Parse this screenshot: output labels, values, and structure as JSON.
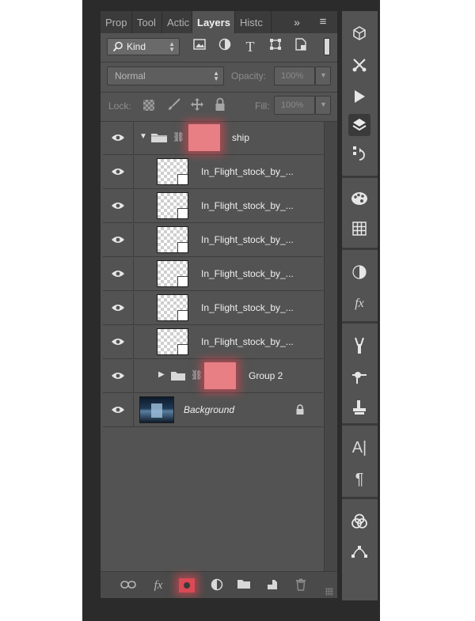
{
  "tabs": [
    {
      "label": "Prop",
      "active": false
    },
    {
      "label": "Tool",
      "active": false
    },
    {
      "label": "Actic",
      "active": false
    },
    {
      "label": "Layers",
      "active": true
    },
    {
      "label": "Histc",
      "active": false
    }
  ],
  "tab_controls": {
    "collapse": "»",
    "menu": "≡"
  },
  "filter": {
    "kind_label": "Kind"
  },
  "blend": {
    "mode": "Normal",
    "opacity_label": "Opacity:",
    "opacity_value": "100%"
  },
  "lock": {
    "label": "Lock:",
    "fill_label": "Fill:",
    "fill_value": "100%"
  },
  "layers": [
    {
      "name": "ship",
      "type": "group-open"
    },
    {
      "name": "In_Flight_stock_by_...",
      "type": "smart-object"
    },
    {
      "name": "In_Flight_stock_by_...",
      "type": "smart-object"
    },
    {
      "name": "In_Flight_stock_by_...",
      "type": "smart-object"
    },
    {
      "name": "In_Flight_stock_by_...",
      "type": "smart-object"
    },
    {
      "name": "In_Flight_stock_by_...",
      "type": "smart-object"
    },
    {
      "name": "In_Flight_stock_by_...",
      "type": "smart-object"
    },
    {
      "name": "Group 2",
      "type": "group-closed"
    },
    {
      "name": "Background",
      "type": "background-locked"
    }
  ],
  "colors": {
    "mask_highlight": "#e87f84",
    "panel": "#535353",
    "dark": "#3b3b3b"
  },
  "bottom_icons": [
    "link-icon",
    "fx-icon",
    "add-mask-icon",
    "adjustment-icon",
    "new-group-icon",
    "new-layer-icon",
    "trash-icon"
  ],
  "dock_icons": [
    "3d-icon",
    "tools-icon",
    "play-icon",
    "layers-icon",
    "history-icon",
    "palette-icon",
    "swatches-icon",
    "adjust-icon",
    "styles-icon",
    "brush-icon",
    "brush-preset-icon",
    "clone-source-icon",
    "character-icon",
    "paragraph-icon",
    "channels-icon",
    "paths-icon"
  ]
}
